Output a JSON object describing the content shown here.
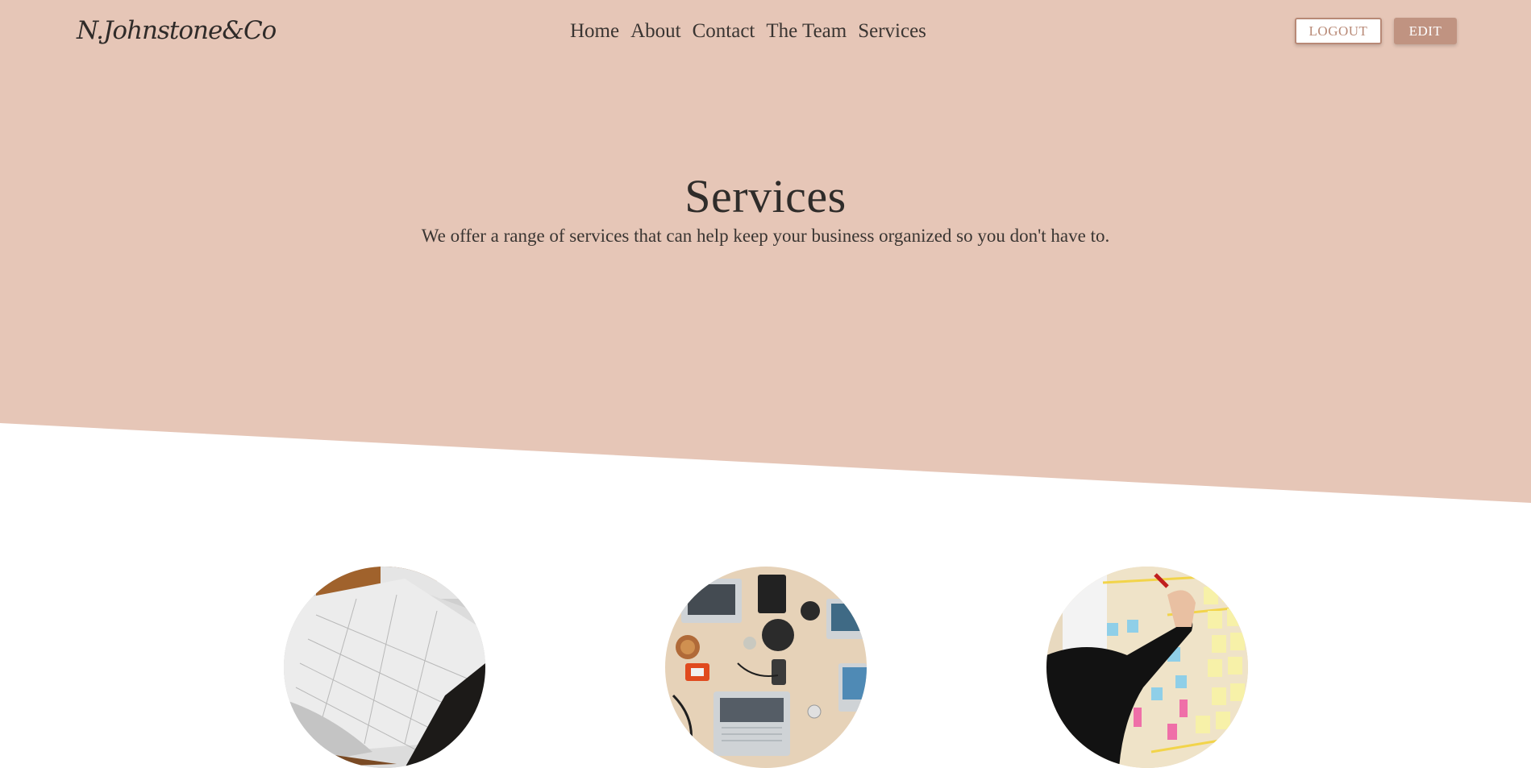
{
  "header": {
    "logo": "N.Johnstone&Co",
    "nav": [
      {
        "label": "Home"
      },
      {
        "label": "About"
      },
      {
        "label": "Contact"
      },
      {
        "label": "The Team"
      },
      {
        "label": "Services"
      }
    ],
    "logout_label": "LOGOUT",
    "edit_label": "EDIT"
  },
  "hero": {
    "title": "Services",
    "subtitle": "We offer a range of services that can help keep your business organized so you don't have to."
  },
  "colors": {
    "hero_background": "#e6c6b7",
    "accent": "#c09381",
    "text": "#3a3532"
  },
  "services": [
    {
      "image": "open-planner-photo"
    },
    {
      "image": "team-laptops-desk-photo"
    },
    {
      "image": "sticky-notes-board-photo"
    }
  ]
}
